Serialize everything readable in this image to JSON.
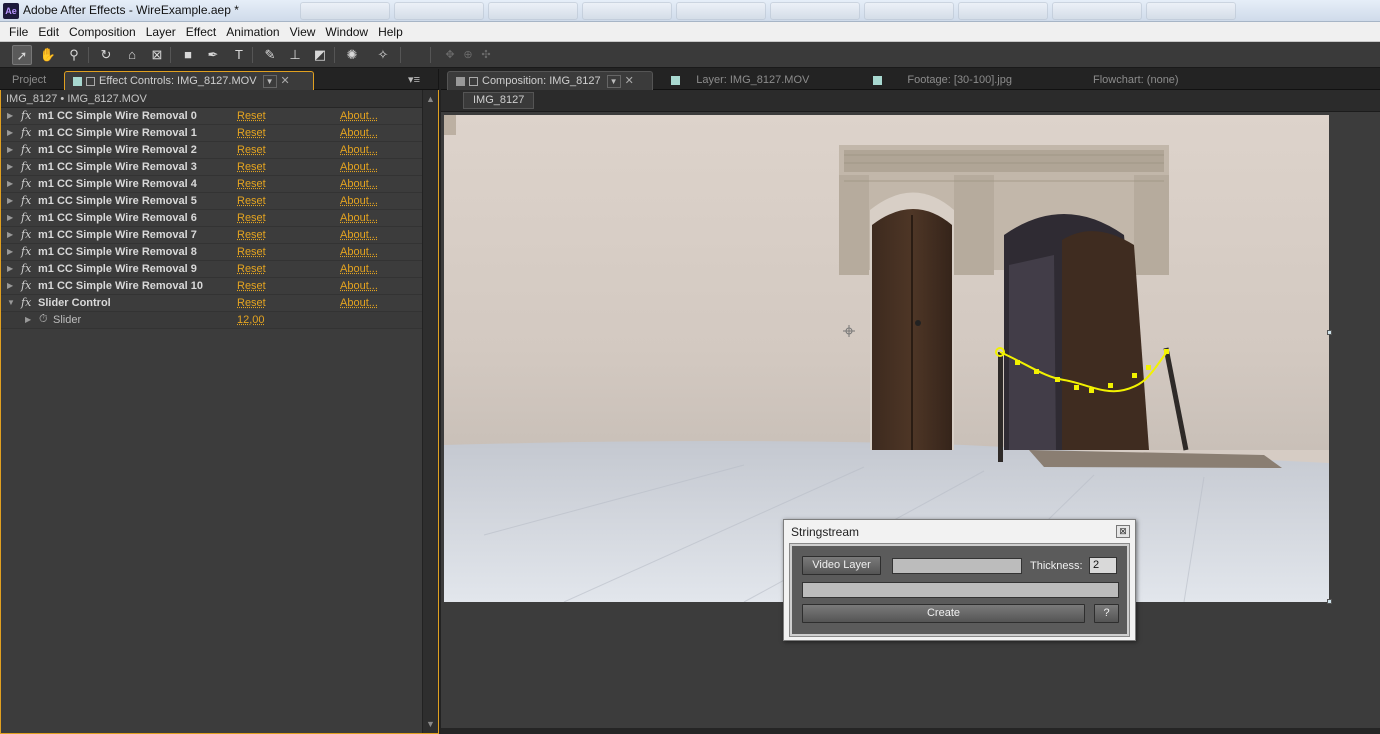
{
  "window": {
    "title": "Adobe After Effects - WireExample.aep *",
    "app_icon": "Ae",
    "taskbar_ghosts": [
      "",
      "",
      "",
      "",
      "",
      "",
      "",
      "",
      "",
      ""
    ]
  },
  "menubar": [
    "File",
    "Edit",
    "Composition",
    "Layer",
    "Effect",
    "Animation",
    "View",
    "Window",
    "Help"
  ],
  "toolbar": {
    "tools": [
      {
        "icon": "selection-tool-icon",
        "glyph": "➚"
      },
      {
        "icon": "hand-tool-icon",
        "glyph": "✋"
      },
      {
        "icon": "zoom-tool-icon",
        "glyph": "⚲"
      },
      {
        "icon": "rotate-tool-icon",
        "glyph": "↻"
      },
      {
        "icon": "camera-orbit-tool-icon",
        "glyph": "⌂"
      },
      {
        "icon": "pan-behind-tool-icon",
        "glyph": "⊠"
      },
      {
        "icon": "rectangle-tool-icon",
        "glyph": "■"
      },
      {
        "icon": "pen-tool-icon",
        "glyph": "✒"
      },
      {
        "icon": "type-tool-icon",
        "glyph": "T"
      },
      {
        "icon": "brush-tool-icon",
        "glyph": "✎"
      },
      {
        "icon": "clone-stamp-tool-icon",
        "glyph": "⊥"
      },
      {
        "icon": "eraser-tool-icon",
        "glyph": "◩"
      },
      {
        "icon": "roto-brush-tool-icon",
        "glyph": "✺"
      },
      {
        "icon": "puppet-pin-tool-icon",
        "glyph": "✧"
      },
      {
        "icon": "axis-local-icon",
        "glyph": "✥"
      },
      {
        "icon": "axis-world-icon",
        "glyph": "⊕"
      },
      {
        "icon": "axis-view-icon",
        "glyph": "✣"
      }
    ]
  },
  "left_panel": {
    "tabs": {
      "project": "Project",
      "effect_controls": "Effect Controls: IMG_8127.MOV"
    },
    "header": "IMG_8127 • IMG_8127.MOV",
    "effects": [
      {
        "name": "m1 CC Simple Wire Removal 0",
        "reset": "Reset",
        "about": "About..."
      },
      {
        "name": "m1 CC Simple Wire Removal 1",
        "reset": "Reset",
        "about": "About..."
      },
      {
        "name": "m1 CC Simple Wire Removal 2",
        "reset": "Reset",
        "about": "About..."
      },
      {
        "name": "m1 CC Simple Wire Removal 3",
        "reset": "Reset",
        "about": "About..."
      },
      {
        "name": "m1 CC Simple Wire Removal 4",
        "reset": "Reset",
        "about": "About..."
      },
      {
        "name": "m1 CC Simple Wire Removal 5",
        "reset": "Reset",
        "about": "About..."
      },
      {
        "name": "m1 CC Simple Wire Removal 6",
        "reset": "Reset",
        "about": "About..."
      },
      {
        "name": "m1 CC Simple Wire Removal 7",
        "reset": "Reset",
        "about": "About..."
      },
      {
        "name": "m1 CC Simple Wire Removal 8",
        "reset": "Reset",
        "about": "About..."
      },
      {
        "name": "m1 CC Simple Wire Removal 9",
        "reset": "Reset",
        "about": "About..."
      },
      {
        "name": "m1 CC Simple Wire Removal 10",
        "reset": "Reset",
        "about": "About..."
      },
      {
        "name": "Slider Control",
        "reset": "Reset",
        "about": "About..."
      }
    ],
    "slider_property": {
      "name": "Slider",
      "value": "12,00"
    },
    "fx_glyph": "fx"
  },
  "right_panel": {
    "tabs": {
      "composition": "Composition: IMG_8127",
      "layer": "Layer: IMG_8127.MOV",
      "footage": "Footage: [30-100].jpg",
      "flowchart": "Flowchart: (none)"
    },
    "comp_subtab": "IMG_8127"
  },
  "dialog": {
    "title": "Stringstream",
    "video_layer_button": "Video Layer",
    "thickness_label": "Thickness:",
    "thickness_value": "2",
    "create_button": "Create",
    "help_button": "?",
    "close_glyph": "⊠"
  },
  "colors": {
    "accent_orange": "#e5a420",
    "panel_focus": "#e0a020",
    "wire_yellow": "#f2f200",
    "tab_swatch": "#a8d8d0"
  }
}
